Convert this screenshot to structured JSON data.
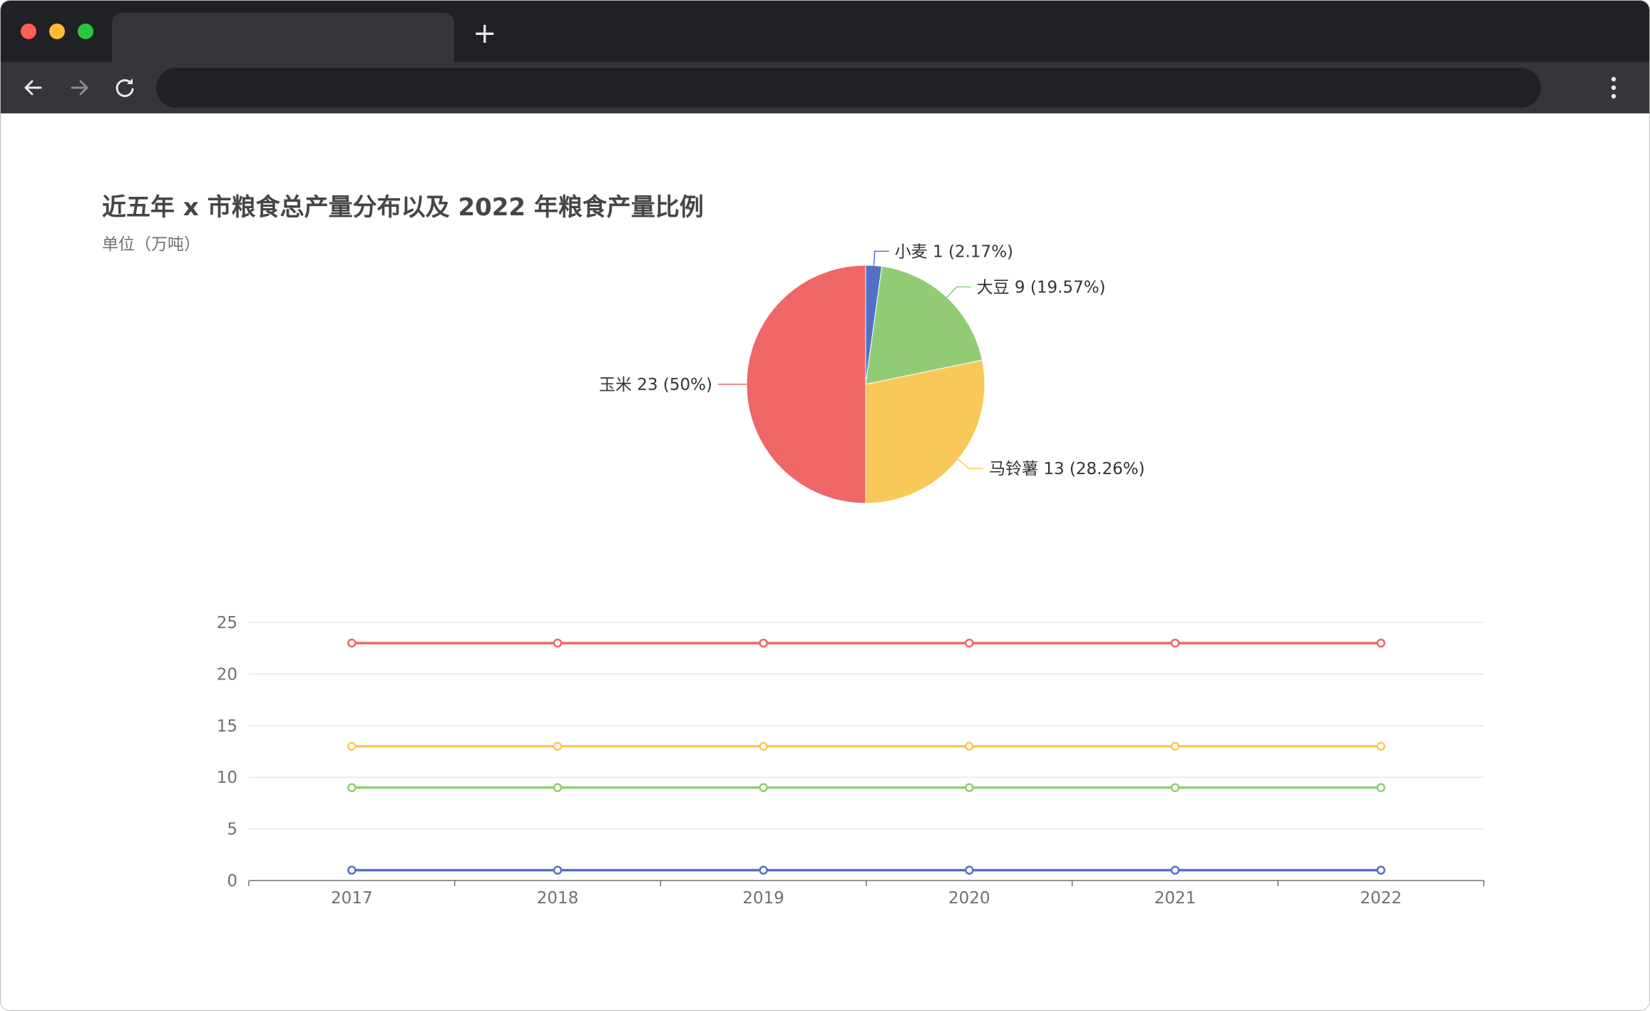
{
  "browser": {
    "new_tab_symbol": "+",
    "icons": [
      "back-arrow-icon",
      "forward-arrow-icon",
      "reload-icon",
      "more-vert-icon"
    ]
  },
  "page": {
    "title": "近五年 x 市粮食总产量分布以及 2022 年粮食产量比例",
    "subtitle": "单位（万吨）"
  },
  "chart_data": [
    {
      "type": "pie",
      "slices": [
        {
          "name": "小麦",
          "value": 1,
          "percent": "2.17%",
          "label": "小麦 1 (2.17%)",
          "color": "#5470c6"
        },
        {
          "name": "大豆",
          "value": 9,
          "percent": "19.57%",
          "label": "大豆 9 (19.57%)",
          "color": "#91cc75"
        },
        {
          "name": "马铃薯",
          "value": 13,
          "percent": "28.26%",
          "label": "马铃薯 13 (28.26%)",
          "color": "#fac858"
        },
        {
          "name": "玉米",
          "value": 23,
          "percent": "50%",
          "label": "玉米 23 (50%)",
          "color": "#ee6666"
        }
      ]
    },
    {
      "type": "line",
      "categories": [
        "2017",
        "2018",
        "2019",
        "2020",
        "2021",
        "2022"
      ],
      "series": [
        {
          "values": [
            1,
            1,
            1,
            1,
            1,
            1
          ],
          "color": "#5470c6"
        },
        {
          "values": [
            9,
            9,
            9,
            9,
            9,
            9
          ],
          "color": "#91cc75"
        },
        {
          "values": [
            13,
            13,
            13,
            13,
            13,
            13
          ],
          "color": "#fac858"
        },
        {
          "values": [
            23,
            23,
            23,
            23,
            23,
            23
          ],
          "color": "#ee6666"
        }
      ],
      "ylim": [
        0,
        25
      ],
      "yticks": [
        "0",
        "5",
        "10",
        "15",
        "20",
        "25"
      ],
      "grid": true
    }
  ]
}
